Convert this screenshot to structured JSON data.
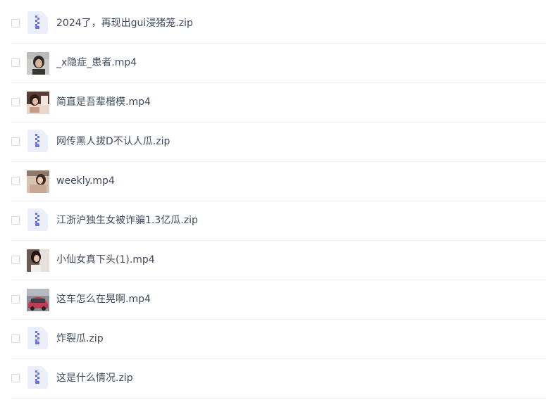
{
  "files": [
    {
      "name": "2024了，再现出gui浸猪笼.zip",
      "icon": "zip-file-icon",
      "type": "zip"
    },
    {
      "name": "_x隐症_患者.mp4",
      "icon": "video-thumbnail",
      "type": "video"
    },
    {
      "name": "简直是吾辈楷模.mp4",
      "icon": "video-thumbnail",
      "type": "video"
    },
    {
      "name": "网传黑人拔D不认人瓜.zip",
      "icon": "zip-file-icon",
      "type": "zip"
    },
    {
      "name": "weekly.mp4",
      "icon": "video-thumbnail",
      "type": "video"
    },
    {
      "name": "江浙沪独生女被诈骗1.3亿瓜.zip",
      "icon": "zip-file-icon",
      "type": "zip"
    },
    {
      "name": "小仙女真下头(1).mp4",
      "icon": "video-thumbnail",
      "type": "video"
    },
    {
      "name": "这车怎么在晃啊.mp4",
      "icon": "video-thumbnail",
      "type": "video"
    },
    {
      "name": "炸裂瓜.zip",
      "icon": "zip-file-icon",
      "type": "zip"
    },
    {
      "name": "这是什么情况.zip",
      "icon": "zip-file-icon",
      "type": "zip"
    }
  ],
  "colors": {
    "zip_icon_bg": "#eceefb",
    "zip_icon_accent": "#6b6ff2",
    "text": "#404a5c"
  }
}
